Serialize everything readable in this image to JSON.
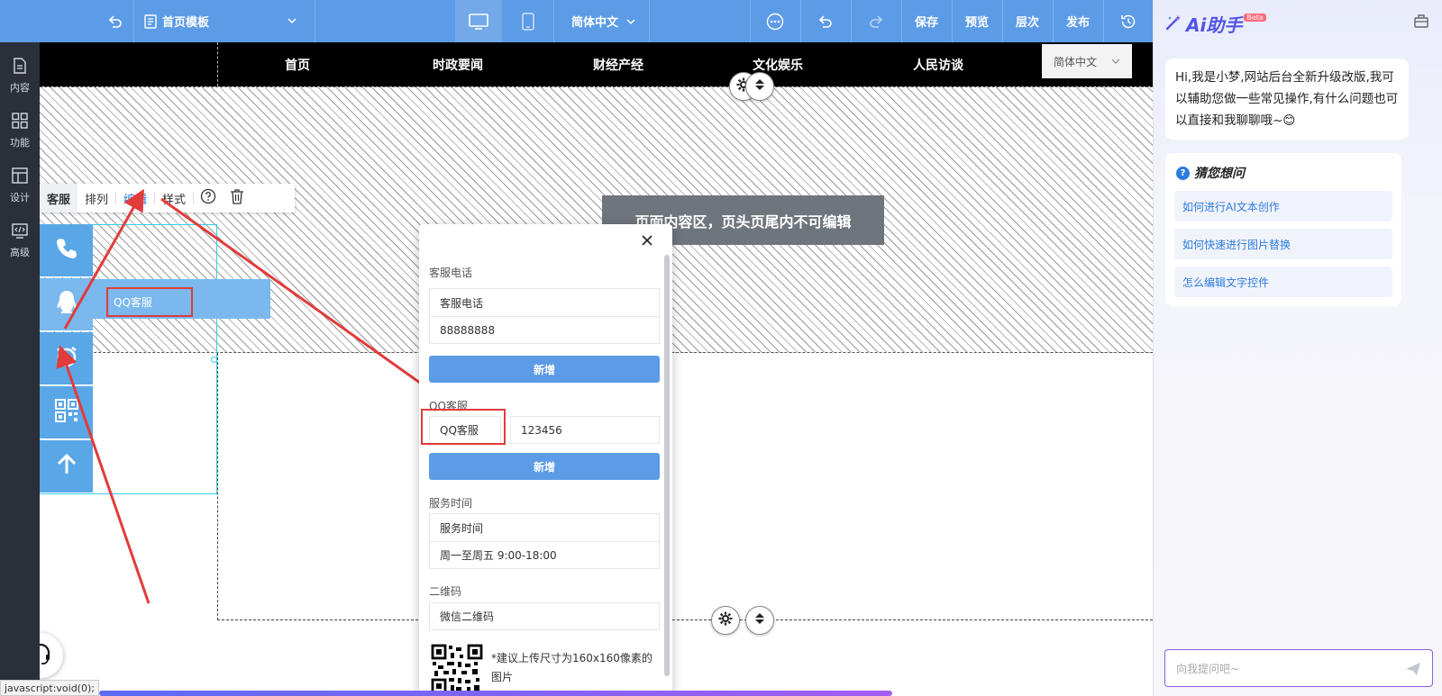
{
  "toolbar": {
    "template_name": "首页模板",
    "language": "简体中文",
    "save": "保存",
    "preview": "预览",
    "layers": "层次",
    "publish": "发布"
  },
  "sidebar": {
    "items": [
      {
        "label": "内容",
        "icon": "document-icon"
      },
      {
        "label": "功能",
        "icon": "grid-icon"
      },
      {
        "label": "设计",
        "icon": "layout-icon"
      },
      {
        "label": "高级",
        "icon": "code-icon"
      }
    ]
  },
  "site_nav": {
    "items": [
      "首页",
      "时政要闻",
      "财经产经",
      "文化娱乐",
      "人民访谈"
    ],
    "language_select": "简体中文"
  },
  "canvas": {
    "notice": "页面内容区，页头页尾内不可编辑"
  },
  "widget_toolbar": {
    "tabs": [
      "客服",
      "排列",
      "编辑",
      "样式"
    ]
  },
  "service_widget": {
    "qq_label": "QQ客服"
  },
  "edit_panel": {
    "phone_section": "客服电话",
    "phone_name": "客服电话",
    "phone_value": "88888888",
    "add_label": "新增",
    "qq_section": "QQ客服",
    "qq_name": "QQ客服",
    "qq_value": "123456",
    "time_section": "服务时间",
    "time_name": "服务时间",
    "time_value": "周一至周五 9:00-18:00",
    "qr_section": "二维码",
    "qr_name": "微信二维码",
    "qr_note": "*建议上传尺寸为160x160像素的图片"
  },
  "status_bar": {
    "link": "javascript:void(0);"
  },
  "ai_assistant": {
    "title": "Ai助手",
    "beta": "Beta",
    "greeting": "Hi,我是小梦,网站后台全新升级改版,我可以辅助您做一些常见操作,有什么问题也可以直接和我聊聊哦~😊",
    "guess_title": "猜您想问",
    "questions": [
      "如何进行AI文本创作",
      "如何快速进行图片替换",
      "怎么编辑文字控件"
    ],
    "input_placeholder": "向我提问吧~"
  },
  "colors": {
    "toolbar_bg": "#5c9be6",
    "sidebar_bg": "#2a2f39",
    "service_blue": "#5aa7e8",
    "annotation_red": "#e23b3b",
    "ai_accent": "#5353e8"
  }
}
